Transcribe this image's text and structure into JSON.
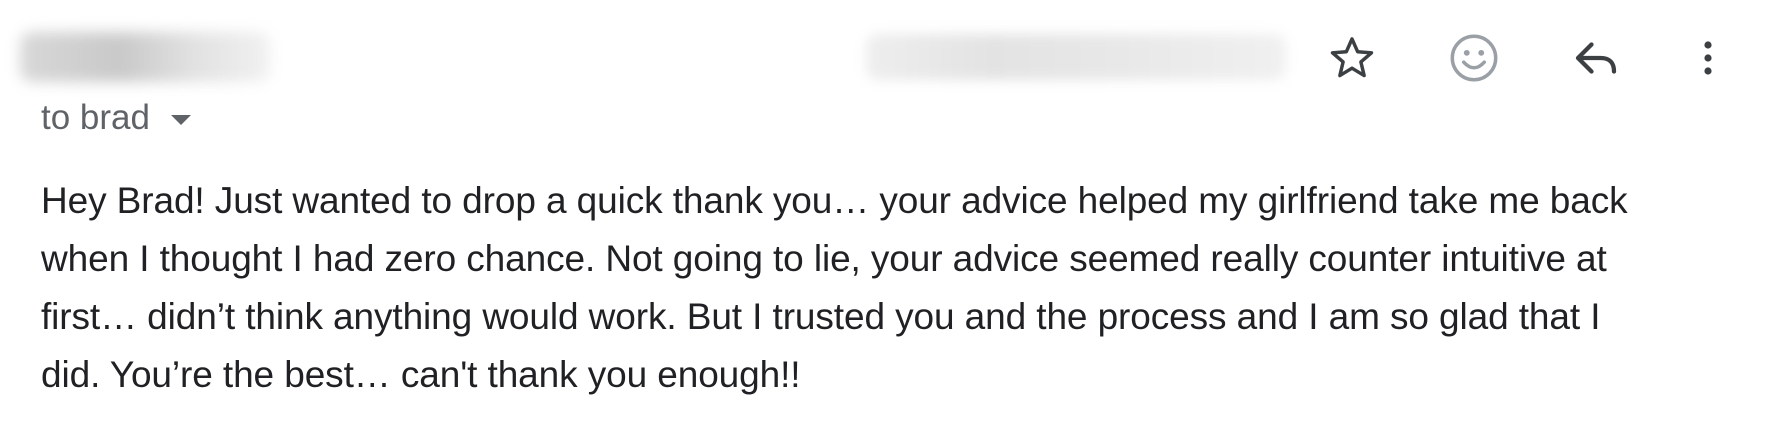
{
  "header": {
    "to_label": "to brad",
    "icons": {
      "star": "star-icon",
      "emoji": "emoji-reaction-icon",
      "reply": "reply-icon",
      "more": "more-vert-icon",
      "recipient_dropdown": "caret-down-icon"
    }
  },
  "body": {
    "lines": [
      "Hey Brad! Just wanted to drop a quick thank you… your advice helped my girlfriend take me back",
      "when I thought I had zero chance. Not going to lie, your advice seemed really counter intuitive at",
      "first… didn’t think anything would work. But I trusted you and the process and I am so glad that I",
      "did. You’re the best… can't thank you enough!!"
    ]
  },
  "colors": {
    "text": "#202124",
    "secondary_text": "#5f6368",
    "icon": "#5f6368"
  }
}
